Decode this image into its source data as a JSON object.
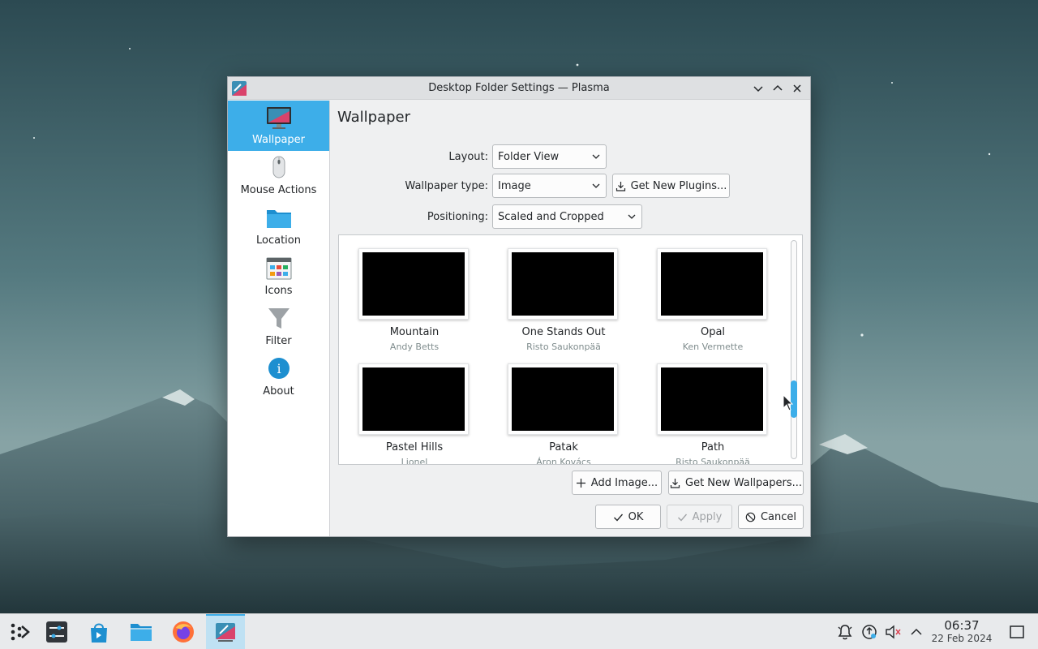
{
  "window": {
    "title": "Desktop Folder Settings — Plasma"
  },
  "sidebar": {
    "items": [
      {
        "label": "Wallpaper",
        "icon": "monitor-icon"
      },
      {
        "label": "Mouse Actions",
        "icon": "mouse-icon"
      },
      {
        "label": "Location",
        "icon": "folder-icon"
      },
      {
        "label": "Icons",
        "icon": "icons-grid-icon"
      },
      {
        "label": "Filter",
        "icon": "funnel-icon"
      },
      {
        "label": "About",
        "icon": "info-icon"
      }
    ]
  },
  "page": {
    "title": "Wallpaper",
    "layout_label": "Layout:",
    "layout_value": "Folder View",
    "wallpaper_type_label": "Wallpaper type:",
    "wallpaper_type_value": "Image",
    "get_plugins_label": "Get New Plugins...",
    "positioning_label": "Positioning:",
    "positioning_value": "Scaled and Cropped"
  },
  "wallpapers": [
    {
      "name": "Mountain",
      "author": "Andy Betts"
    },
    {
      "name": "One Stands Out",
      "author": "Risto Saukonpää"
    },
    {
      "name": "Opal",
      "author": "Ken Vermette"
    },
    {
      "name": "Pastel Hills",
      "author": "Lionel"
    },
    {
      "name": "Patak",
      "author": "Áron Kovács"
    },
    {
      "name": "Path",
      "author": "Risto Saukonpää"
    }
  ],
  "buttons": {
    "add_image": "Add Image...",
    "get_new_wallpapers": "Get New Wallpapers...",
    "ok": "OK",
    "apply": "Apply",
    "cancel": "Cancel"
  },
  "taskbar": {
    "time": "06:37",
    "date": "22 Feb 2024"
  },
  "colors": {
    "accent": "#3daee9",
    "window_bg": "#eff0f1"
  }
}
